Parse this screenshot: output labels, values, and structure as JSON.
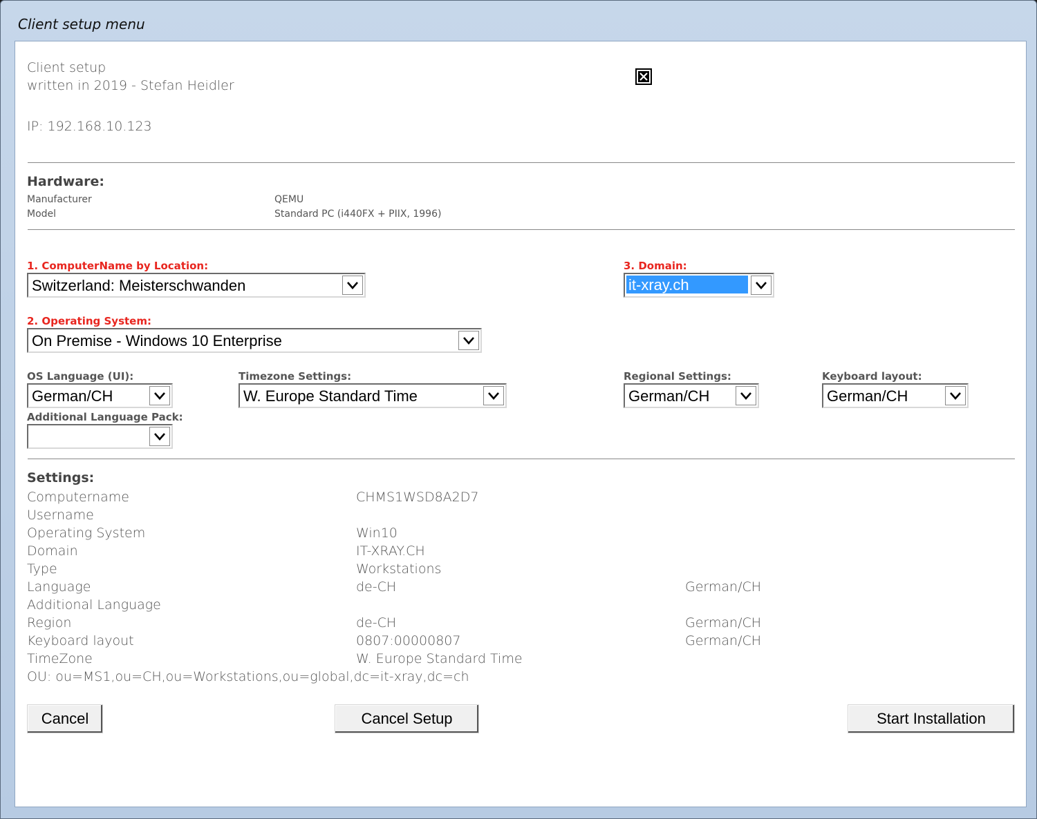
{
  "window": {
    "title": "Client setup menu"
  },
  "header": {
    "line1": "Client setup",
    "line2": "written in 2019 - Stefan Heidler",
    "ip": "IP: 192.168.10.123"
  },
  "hardware": {
    "title": "Hardware:",
    "rows": [
      {
        "label": "Manufacturer",
        "value": "QEMU"
      },
      {
        "label": "Model",
        "value": "Standard PC (i440FX + PIIX, 1996)"
      }
    ]
  },
  "form": {
    "computername_label": "1. ComputerName by Location:",
    "computername_value": "Switzerland: Meisterschwanden",
    "domain_label": "3. Domain:",
    "domain_value": "it-xray.ch",
    "os_label": "2. Operating System:",
    "os_value": "On Premise - Windows 10 Enterprise",
    "os_language_label": "OS Language (UI):",
    "os_language_value": "German/CH",
    "timezone_label": "Timezone Settings:",
    "timezone_value": "W. Europe Standard Time",
    "regional_label": "Regional Settings:",
    "regional_value": "German/CH",
    "keyboard_label": "Keyboard layout:",
    "keyboard_value": "German/CH",
    "addlang_label": "Additional Language Pack:",
    "addlang_value": ""
  },
  "settings": {
    "title": "Settings:",
    "rows": [
      {
        "label": "Computername",
        "value": "CHMS1WSD8A2D7",
        "extra": ""
      },
      {
        "label": "Username",
        "value": "",
        "extra": ""
      },
      {
        "label": "Operating System",
        "value": "Win10",
        "extra": ""
      },
      {
        "label": "Domain",
        "value": "IT-XRAY.CH",
        "extra": ""
      },
      {
        "label": "Type",
        "value": "Workstations",
        "extra": ""
      },
      {
        "label": "Language",
        "value": "de-CH",
        "extra": "German/CH"
      },
      {
        "label": "Additional Language",
        "value": "",
        "extra": ""
      },
      {
        "label": "Region",
        "value": "de-CH",
        "extra": "German/CH"
      },
      {
        "label": "Keyboard layout",
        "value": "0807:00000807",
        "extra": "German/CH"
      },
      {
        "label": "TimeZone",
        "value": "W. Europe Standard Time",
        "extra": ""
      }
    ],
    "ou": "OU: ou=MS1,ou=CH,ou=Workstations,ou=global,dc=it-xray,dc=ch"
  },
  "buttons": {
    "cancel": "Cancel",
    "cancel_setup": "Cancel Setup",
    "start": "Start Installation"
  },
  "icons": {
    "close": "close-icon",
    "dropdown": "chevron-down-icon"
  }
}
